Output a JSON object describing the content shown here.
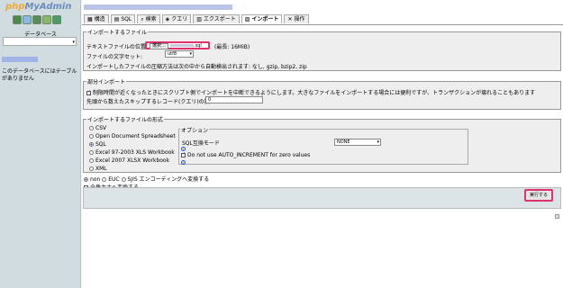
{
  "sidebar": {
    "logo_main": "php",
    "logo_accent": "MyAdmin",
    "db_label": "データベース",
    "db_select_value": "",
    "no_tables_text": "このデータベースにはテーブルがありません"
  },
  "tabs": [
    {
      "label": "構造",
      "icon": "structure-icon"
    },
    {
      "label": "SQL",
      "icon": "sql-icon"
    },
    {
      "label": "検索",
      "icon": "search-icon"
    },
    {
      "label": "クエリ",
      "icon": "query-icon"
    },
    {
      "label": "エクスポート",
      "icon": "export-icon"
    },
    {
      "label": "インポート",
      "icon": "import-icon",
      "active": true
    },
    {
      "label": "操作",
      "icon": "operations-icon"
    }
  ],
  "import_file": {
    "legend": "インポートするファイル",
    "file_location_label": "テキストファイルの位置",
    "browse_label": "選択…",
    "file_ext": ".sql",
    "max_size": "(最長: 16MiB)",
    "charset_label": "ファイルの文字セット:",
    "charset_value": "utf8",
    "compression_note": "インポートしたファイルの圧縮方法は次の中から自動検出されます: なし, gzip, bzip2, zip"
  },
  "partial_import": {
    "legend": "部分インポート",
    "interrupt_label": "制限時間が近くなったときにスクリプト側でインポートを中断できるようにします。大きなファイルをインポートする場合には便利ですが、トランザクションが壊れることもあります",
    "skip_label": "先頭から数えたスキップするレコード(クエリ)の数",
    "skip_value": "0"
  },
  "format": {
    "legend": "インポートするファイルの形式",
    "options": [
      {
        "label": "CSV",
        "selected": false
      },
      {
        "label": "Open Document Spreadsheet",
        "selected": false
      },
      {
        "label": "SQL",
        "selected": true
      },
      {
        "label": "Excel 97-2003 XLS Workbook",
        "selected": false
      },
      {
        "label": "Excel 2007 XLSX Workbook",
        "selected": false
      },
      {
        "label": "XML",
        "selected": false
      }
    ],
    "options_legend": "オプション",
    "compat_label": "SQL互換モード",
    "compat_value": "NONE",
    "auto_increment_label": "Do not use AUTO_INCREMENT for zero values"
  },
  "encoding": {
    "options": [
      {
        "label": "non",
        "selected": true
      },
      {
        "label": "EUC",
        "selected": false
      },
      {
        "label": "SJIS",
        "selected": false
      }
    ],
    "convert_label": "エンコーディングへ変換する",
    "kana_label": "全角カナへ変換する"
  },
  "submit_label": "実行する",
  "accent_color": "#e0306e"
}
